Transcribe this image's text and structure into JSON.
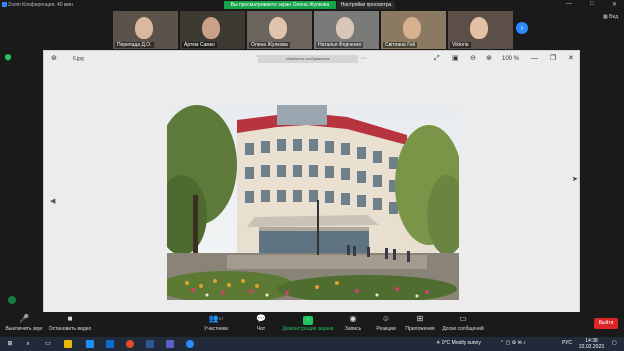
{
  "window": {
    "title": "Zoom Конференция, 40 мин",
    "minimize": "—",
    "maximize": "□",
    "close": "✕"
  },
  "banner": {
    "sharing_text": "Вы просматриваете экран Олена Жулкова",
    "view_settings": "Настройки просмотра"
  },
  "participants": [
    {
      "name": "Перепада Д.О.",
      "bg": "#5b5249",
      "face": "#d9b8a0"
    },
    {
      "name": "Артем Самко",
      "bg": "#3d3a34",
      "face": "#c9a088"
    },
    {
      "name": "Олена Жулкова",
      "bg": "#6b645c",
      "face": "#e0c4ad"
    },
    {
      "name": "Наталья Федченко",
      "bg": "#7a7a78",
      "face": "#d8c6b8"
    },
    {
      "name": "Світлана Гей",
      "bg": "#8a7a62",
      "face": "#d7b090"
    },
    {
      "name": "Viktoria",
      "bg": "#5c4f47",
      "face": "#e2c1a6"
    }
  ],
  "view_label": "Вид",
  "viewer": {
    "file_name": "6.jpg",
    "zoom": "100 %",
    "toolbar_hint": "Изменить изображение"
  },
  "controls": {
    "mute": "Выключить звук",
    "stop_video": "Остановить видео",
    "participants": "Участники",
    "participants_count": "17",
    "chat": "Чат",
    "share": "Демонстрация экрана",
    "record": "Запись",
    "reactions": "Реакции",
    "apps": "Приложения",
    "whiteboards": "Доски сообщений",
    "leave": "Выйти"
  },
  "taskbar": {
    "weather": "0°C  Mostly sunny",
    "lang": "РУС",
    "time": "14:38",
    "date": "22.02.2023"
  },
  "colors": {
    "accent": "#2d8cff",
    "share_green": "#22c55e",
    "leave_red": "#dc2626"
  }
}
